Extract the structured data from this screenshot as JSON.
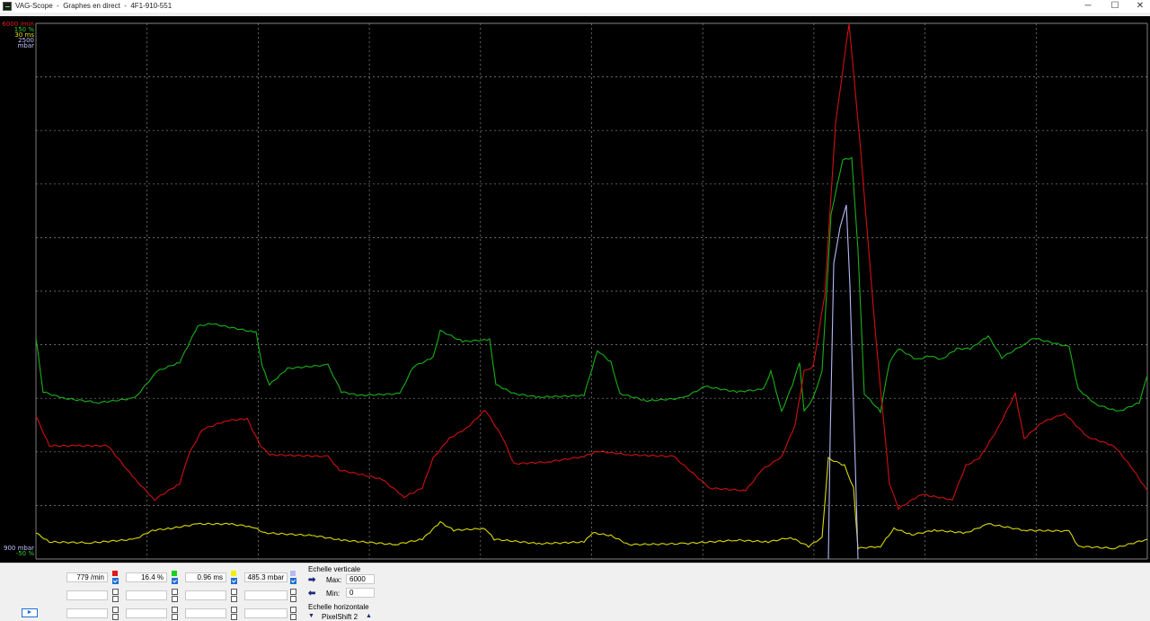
{
  "window": {
    "title": "VAG-Scope  -  Graphes en direct  -  4F1-910-551",
    "minimize": "─",
    "maximize": "☐",
    "close": "✕"
  },
  "scope": {
    "background": "#000000",
    "grid_color": "#9a9a9a",
    "scale_top": [
      "6000 /min",
      "150 %",
      "30 ms",
      "2500 mbar"
    ],
    "scale_bottom": [
      "900 mbar",
      "-50 %"
    ],
    "colors": {
      "red": "#d01010",
      "green": "#18b018",
      "yellow": "#d8d800",
      "lavender": "#b8b8f8"
    }
  },
  "channels": {
    "row1": [
      {
        "value": "779 /min",
        "color": "#e01818",
        "checked": true
      },
      {
        "value": "16.4 %",
        "color": "#18d018",
        "checked": true
      },
      {
        "value": "0.96 ms",
        "color": "#f0f000",
        "checked": true
      },
      {
        "value": "485.3 mbar",
        "color": "#b8b8f8",
        "checked": true
      }
    ]
  },
  "vertical_scale": {
    "title": "Echelle verticale",
    "max_label": "Max:",
    "max_value": "6000",
    "min_label": "Min:",
    "min_value": "0"
  },
  "horizontal_scale": {
    "title": "Echelle horizontale",
    "mode": "PixelShift 2"
  },
  "play_icon": "►"
}
